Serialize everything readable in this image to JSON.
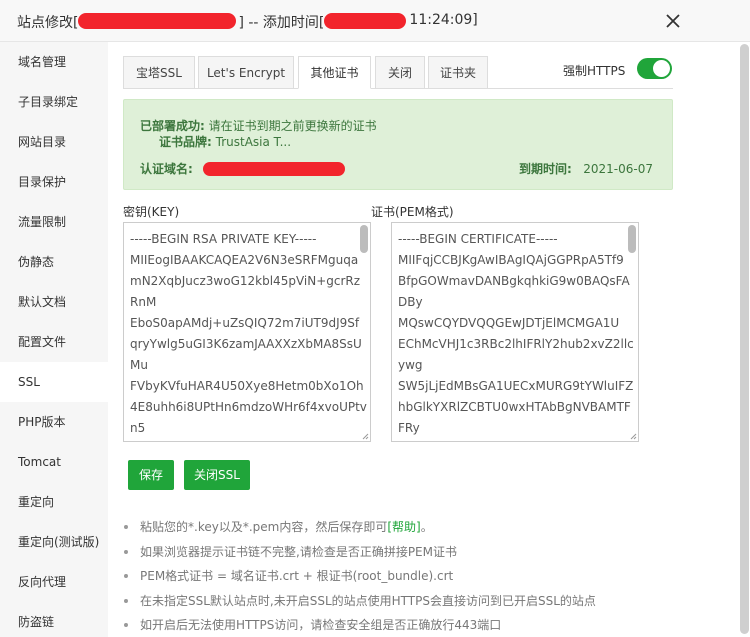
{
  "header": {
    "title_prefix": "站点修改[",
    "title_middle": "] -- 添加时间[",
    "title_suffix": "11:24:09]",
    "close_icon": "close-icon"
  },
  "sidebar": {
    "items": [
      {
        "label": "域名管理"
      },
      {
        "label": "子目录绑定"
      },
      {
        "label": "网站目录"
      },
      {
        "label": "目录保护"
      },
      {
        "label": "流量限制"
      },
      {
        "label": "伪静态"
      },
      {
        "label": "默认文档"
      },
      {
        "label": "配置文件"
      },
      {
        "label": "SSL",
        "active": true
      },
      {
        "label": "PHP版本"
      },
      {
        "label": "Tomcat"
      },
      {
        "label": "重定向"
      },
      {
        "label": "重定向(测试版)"
      },
      {
        "label": "反向代理"
      },
      {
        "label": "防盗链"
      }
    ]
  },
  "tabs": [
    {
      "label": "宝塔SSL"
    },
    {
      "label": "Let's Encrypt"
    },
    {
      "label": "其他证书",
      "active": true
    },
    {
      "label": "关闭"
    },
    {
      "label": "证书夹"
    }
  ],
  "https": {
    "label": "强制HTTPS",
    "enabled": true
  },
  "status": {
    "deployed_label": "已部署成功:",
    "deployed_text": "请在证书到期之前更换新的证书",
    "brand_label": "证书品牌:",
    "brand_value": "TrustAsia T...",
    "domain_label": "认证域名:",
    "expiry_label": "到期时间:",
    "expiry_value": "2021-06-07"
  },
  "key": {
    "label": "密钥(KEY)",
    "lines": [
      "-----BEGIN RSA PRIVATE KEY-----",
      "MIIEogIBAAKCAQEA2V6N3eSRFMguqa",
      "mN2XqbJucz3woG12kbl45pViN+gcrRz",
      "RnM",
      "EboS0apAMdj+uZsQIQ72m7iUT9dJ9Sf",
      "qryYwlg5uGI3K6zamJAAXXzXbMA8SsU",
      "Mu",
      "FVbyKVfuHAR4U50Xye8Hetm0bXo1Oh",
      "4E8uhh6i8UPtHn6mdzoWHr6f4xvoUPtv",
      "n5"
    ]
  },
  "cert": {
    "label": "证书(PEM格式)",
    "lines": [
      "-----BEGIN CERTIFICATE-----",
      "MIIFqjCCBJKgAwIBAgIQAjGGPRpA5Tf9",
      "BfpGOWmavDANBgkqhkiG9w0BAQsFA",
      "DBy",
      "MQswCQYDVQQGEwJDTjElMCMGA1U",
      "EChMcVHJ1c3RBc2lhIFRlY2hub2xvZ2llc",
      "ywg",
      "SW5jLjEdMBsGA1UECxMURG9tYWluIFZ",
      "hbGlkYXRlZCBTU0wxHTAbBgNVBAMTF",
      "FRy"
    ]
  },
  "buttons": {
    "save": "保存",
    "close_ssl": "关闭SSL"
  },
  "tips": {
    "t1_before": "粘贴您的*.key以及*.pem内容，然后保存即可",
    "t1_link": "[帮助]",
    "t1_after": "。",
    "t2": "如果浏览器提示证书链不完整,请检查是否正确拼接PEM证书",
    "t3": "PEM格式证书 = 域名证书.crt + 根证书(root_bundle).crt",
    "t4": "在未指定SSL默认站点时,未开启SSL的站点使用HTTPS会直接访问到已开启SSL的站点",
    "t5": "如开启后无法使用HTTPS访问，请检查安全组是否正确放行443端口"
  },
  "colors": {
    "accent": "#20a53a",
    "redaction": "#f2242c",
    "success_bg": "#dff0d8",
    "success_text": "#3c763d"
  }
}
